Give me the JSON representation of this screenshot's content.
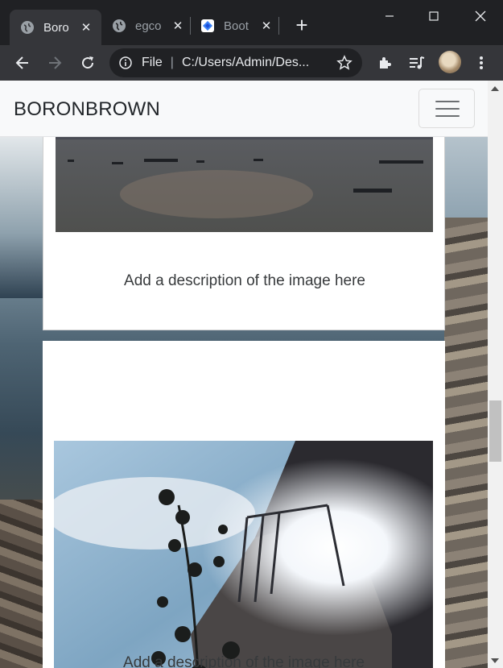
{
  "browser": {
    "tabs": [
      {
        "title": "Boro",
        "active": true,
        "icon": "globe-icon"
      },
      {
        "title": "egco",
        "active": false,
        "icon": "globe-icon"
      },
      {
        "title": "Boot",
        "active": false,
        "icon": "bootstrap-icon"
      }
    ],
    "close_glyph": "✕",
    "new_tab_glyph": "+",
    "omnibox": {
      "scheme_label": "File",
      "separator": "|",
      "url": "C:/Users/Admin/Des..."
    }
  },
  "page": {
    "brand": "BORONBROWN",
    "cards": [
      {
        "description": "Add a description of the image here"
      },
      {
        "description": "Add a description of the image here"
      }
    ]
  },
  "colors": {
    "navbar_bg": "#f8f9fa",
    "chrome_dark": "#202124",
    "chrome_toolbar": "#35363a"
  }
}
